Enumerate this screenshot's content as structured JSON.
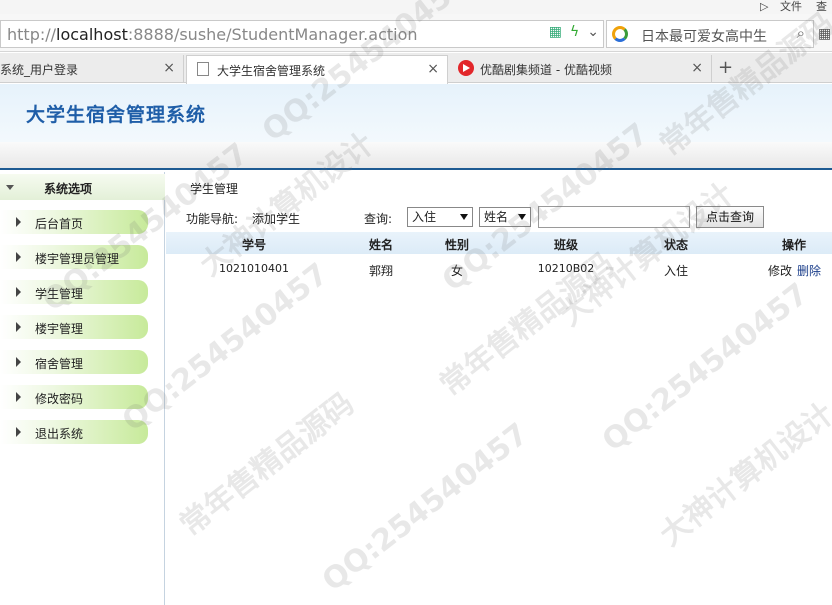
{
  "browser": {
    "top_right": [
      "文件",
      "查"
    ],
    "url_scheme": "http://",
    "url_host": "localhost",
    "url_rest": ":8888/sushe/StudentManager.action",
    "search_text": "日本最可爱女高中生",
    "tabs": [
      {
        "label": "系统_用户登录"
      },
      {
        "label": "大学生宿舍管理系统"
      },
      {
        "label": "优酷剧集频道 - 优酷视频"
      }
    ],
    "close_glyph": "×",
    "new_tab_glyph": "+"
  },
  "app": {
    "title": "大学生宿舍管理系统"
  },
  "sidebar": {
    "header": "系统选项",
    "items": [
      {
        "label": "后台首页"
      },
      {
        "label": "楼宇管理员管理"
      },
      {
        "label": "学生管理"
      },
      {
        "label": "楼宇管理"
      },
      {
        "label": "宿舍管理"
      },
      {
        "label": "修改密码"
      },
      {
        "label": "退出系统"
      }
    ]
  },
  "main": {
    "title": "学生管理",
    "func_nav_label": "功能导航:",
    "add_link": "添加学生",
    "query_label": "查询:",
    "status_select": "入住",
    "field_select": "姓名",
    "search_value": "",
    "query_button": "点击查询",
    "columns": [
      "学号",
      "姓名",
      "性别",
      "班级",
      "状态",
      "操作"
    ],
    "rows": [
      {
        "id": "1021010401",
        "name": "郭翔",
        "gender": "女",
        "class": "10210B02",
        "status": "入住",
        "edit": "修改",
        "delete": "删除"
      }
    ]
  },
  "watermarks": [
    "QQ:254540457",
    "大神计算机设计",
    "常年售精品源码"
  ]
}
